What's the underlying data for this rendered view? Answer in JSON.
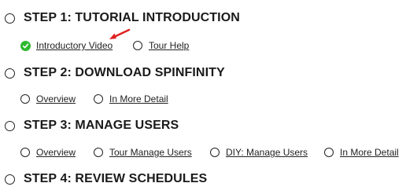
{
  "steps": [
    {
      "title": "STEP 1: TUTORIAL INTRODUCTION",
      "links": [
        {
          "label": "Introductory Video",
          "completed": true
        },
        {
          "label": "Tour Help",
          "completed": false
        }
      ]
    },
    {
      "title": "STEP 2: DOWNLOAD SPINFINITY",
      "links": [
        {
          "label": "Overview",
          "completed": false
        },
        {
          "label": "In More Detail",
          "completed": false
        }
      ]
    },
    {
      "title": "STEP 3: MANAGE USERS",
      "links": [
        {
          "label": "Overview",
          "completed": false
        },
        {
          "label": "Tour Manage Users",
          "completed": false
        },
        {
          "label": "DIY: Manage Users",
          "completed": false
        },
        {
          "label": "In More Detail",
          "completed": false
        }
      ]
    },
    {
      "title": "STEP 4: REVIEW SCHEDULES",
      "links": []
    }
  ],
  "icons": {
    "step_radio": "radio-empty-icon",
    "link_radio": "radio-empty-icon",
    "completed": "check-circle-icon",
    "pointer": "red-arrow-icon"
  },
  "colors": {
    "completed_green": "#2eb82e",
    "arrow_red": "#e02020",
    "text": "#1a1a1a"
  }
}
